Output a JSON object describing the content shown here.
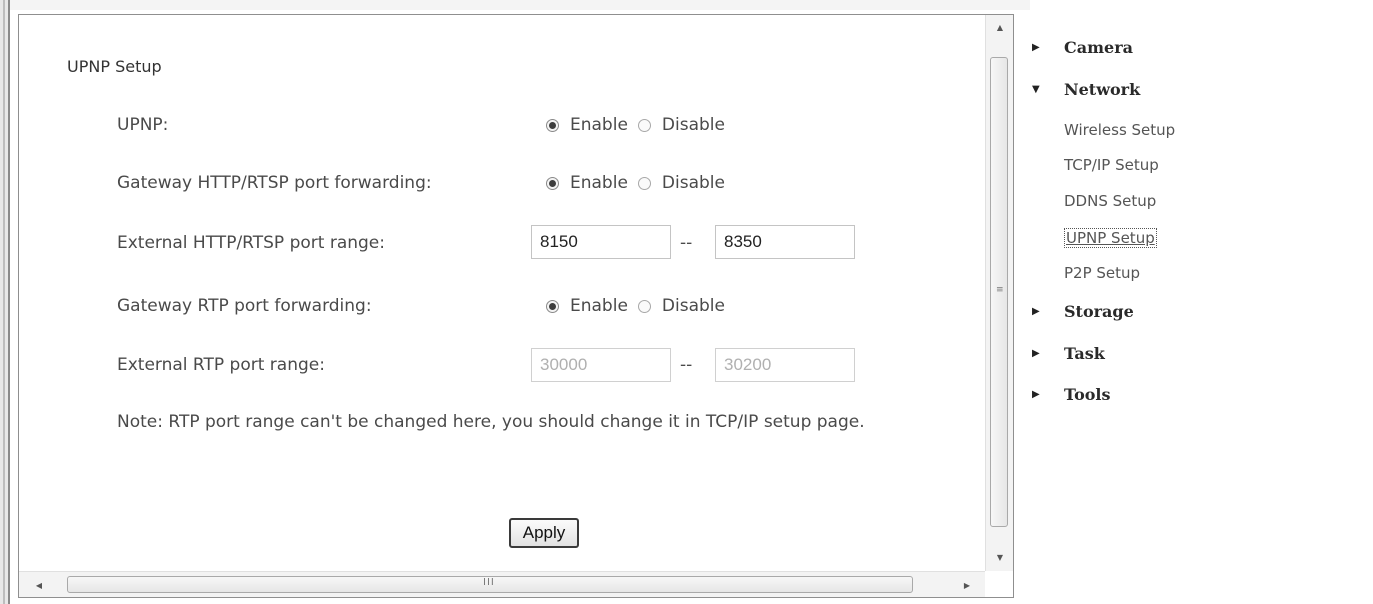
{
  "panel": {
    "title": "UPNP Setup",
    "rows": [
      {
        "label": "UPNP:"
      },
      {
        "label": "Gateway HTTP/RTSP port forwarding:"
      },
      {
        "label": "External HTTP/RTSP port range:"
      },
      {
        "label": "Gateway RTP port forwarding:"
      },
      {
        "label": "External RTP port range:"
      }
    ],
    "enable_label": "Enable",
    "disable_label": "Disable",
    "http_port_start": "8150",
    "http_port_end": "8350",
    "rtp_port_start": "30000",
    "rtp_port_end": "30200",
    "range_separator": "--",
    "note": "Note: RTP port range can't be changed here, you should change it in TCP/IP setup page.",
    "apply_label": "Apply"
  },
  "nav": {
    "camera": "Camera",
    "network": "Network",
    "network_items": [
      "Wireless Setup",
      "TCP/IP Setup",
      "DDNS Setup",
      "UPNP Setup",
      "P2P Setup"
    ],
    "storage": "Storage",
    "task": "Task",
    "tools": "Tools"
  },
  "icons": {
    "collapsed": "triangle-right",
    "expanded": "triangle-down"
  }
}
